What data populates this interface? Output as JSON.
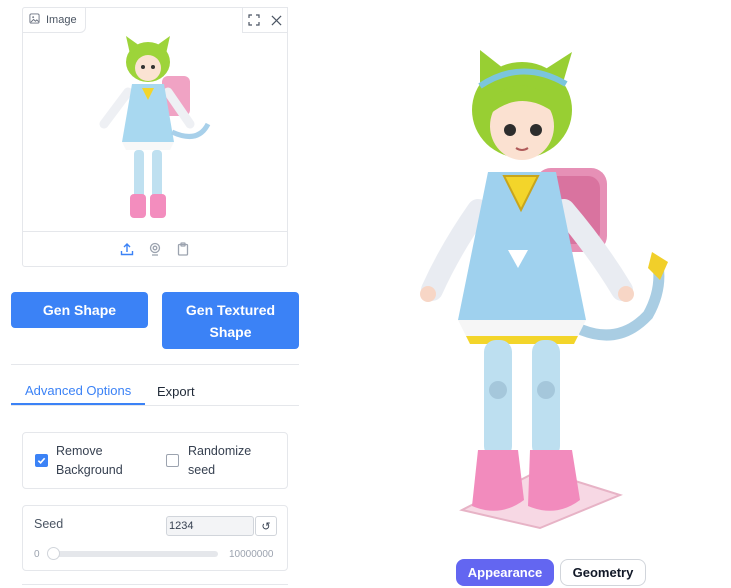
{
  "image_panel": {
    "label": "Image",
    "icons": [
      "image-icon",
      "fullscreen-icon",
      "close-icon",
      "upload-icon",
      "webcam-icon",
      "clipboard-icon"
    ]
  },
  "buttons": {
    "gen_shape": "Gen Shape",
    "gen_textured": "Gen Textured Shape"
  },
  "tabs": [
    {
      "label": "Advanced Options",
      "active": true
    },
    {
      "label": "Export",
      "active": false
    }
  ],
  "options": {
    "remove_background": {
      "label": "Remove Background",
      "checked": true
    },
    "randomize_seed": {
      "label": "Randomize seed",
      "checked": false
    }
  },
  "seed": {
    "label": "Seed",
    "value": "1234",
    "reset_icon": "reset-icon",
    "min": "0",
    "max": "10000000",
    "slider_fraction": 0.0001234
  },
  "view_toggle": {
    "appearance": "Appearance",
    "geometry": "Geometry",
    "active": "Appearance"
  },
  "colors": {
    "primary": "#3b82f6",
    "toggle_active": "#6366f1"
  }
}
